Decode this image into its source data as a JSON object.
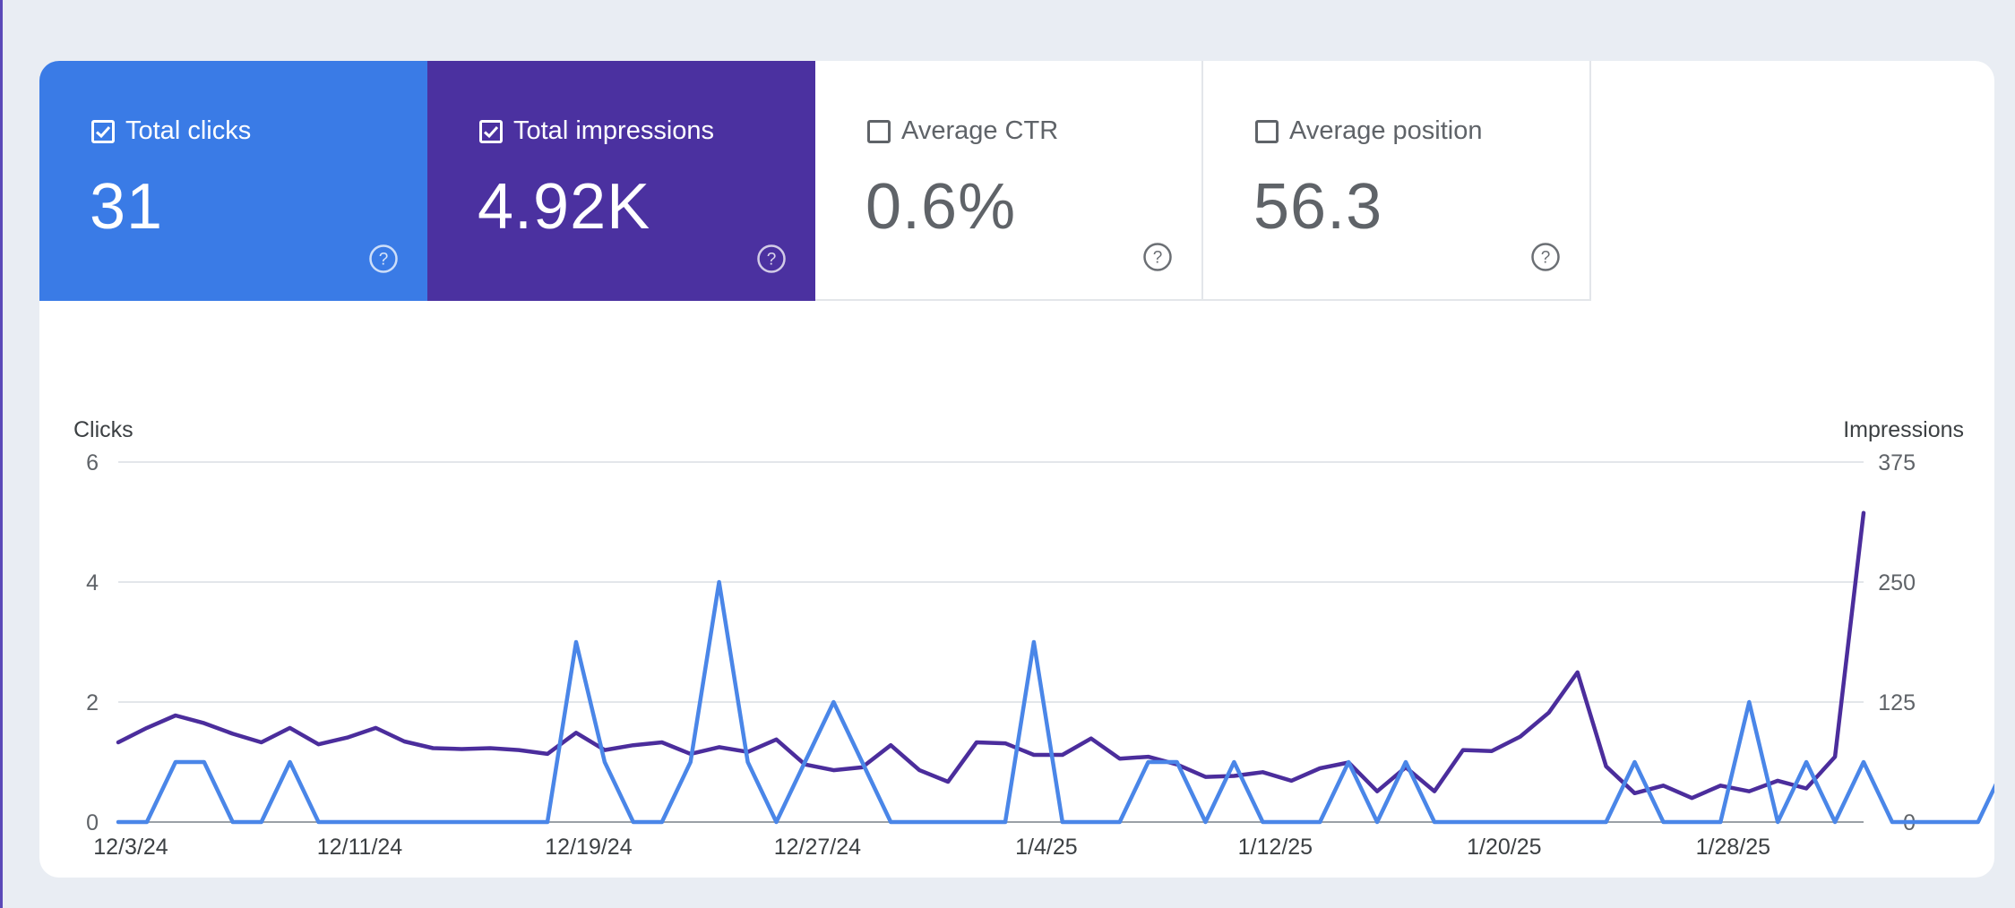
{
  "metrics": [
    {
      "label": "Total clicks",
      "value": "31",
      "checked": true
    },
    {
      "label": "Total impressions",
      "value": "4.92K",
      "checked": true
    },
    {
      "label": "Average CTR",
      "value": "0.6%",
      "checked": false
    },
    {
      "label": "Average position",
      "value": "56.3",
      "checked": false
    }
  ],
  "icons": {
    "checkbox": "checkbox-icon",
    "help": "help-icon"
  },
  "colors": {
    "clicks": "#3a7be6",
    "impressions": "#4b31a0",
    "clicks_line": "#4a86e8",
    "impressions_line": "#4b2d9c"
  },
  "chart_data": {
    "type": "line",
    "left_axis_label": "Clicks",
    "right_axis_label": "Impressions",
    "left_ticks": [
      0,
      2,
      4,
      6
    ],
    "right_ticks": [
      0,
      125,
      250,
      375
    ],
    "ylim_left": [
      0,
      6
    ],
    "ylim_right": [
      0,
      375
    ],
    "x_tick_labels": [
      "12/3/24",
      "12/11/24",
      "12/19/24",
      "12/27/24",
      "1/4/25",
      "1/12/25",
      "1/20/25",
      "1/28/25"
    ],
    "x_tick_indices": [
      0,
      8,
      16,
      24,
      32,
      40,
      48,
      56
    ],
    "series": [
      {
        "name": "Clicks",
        "axis": "left",
        "values": [
          0,
          0,
          1,
          1,
          0,
          0,
          1,
          0,
          0,
          0,
          0,
          0,
          0,
          0,
          0,
          0,
          3,
          1,
          0,
          0,
          1,
          4,
          1,
          0,
          1,
          2,
          1,
          0,
          0,
          0,
          0,
          0,
          3,
          0,
          0,
          0,
          1,
          1,
          0,
          1,
          0,
          0,
          0,
          1,
          0,
          1,
          0,
          0,
          0,
          0,
          0,
          0,
          0,
          1,
          0,
          0,
          0,
          2,
          0,
          1,
          0,
          1,
          0,
          0,
          0,
          0,
          1
        ]
      },
      {
        "name": "Impressions",
        "axis": "right",
        "values": [
          83,
          98,
          111,
          103,
          92,
          83,
          98,
          81,
          88,
          98,
          84,
          77,
          76,
          77,
          75,
          71,
          93,
          75,
          80,
          83,
          71,
          78,
          73,
          86,
          60,
          54,
          57,
          80,
          54,
          42,
          83,
          82,
          70,
          70,
          87,
          66,
          68,
          60,
          47,
          48,
          52,
          43,
          56,
          62,
          32,
          57,
          32,
          75,
          74,
          89,
          114,
          156,
          58,
          30,
          38,
          25,
          38,
          32,
          43,
          35,
          68,
          322
        ]
      }
    ]
  }
}
